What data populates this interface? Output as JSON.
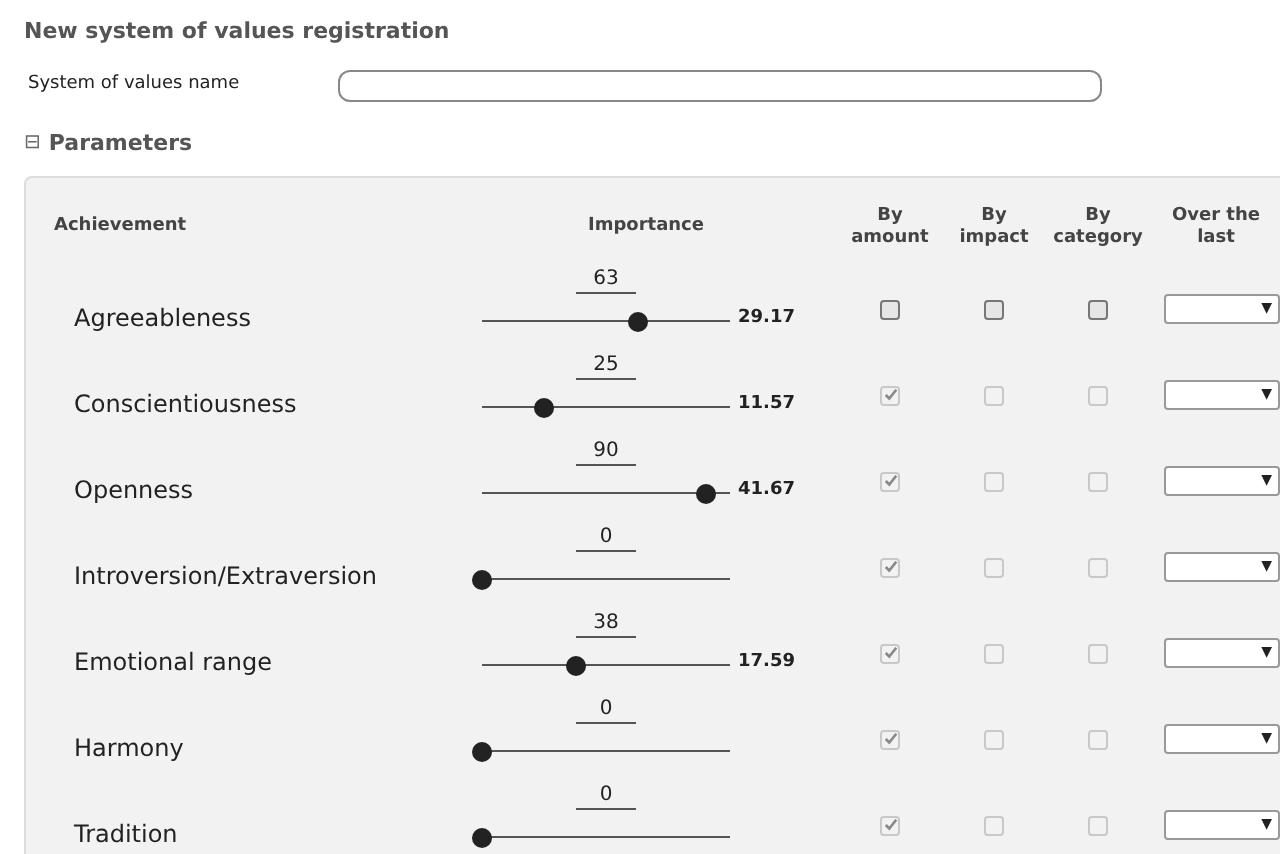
{
  "title": "New system of values registration",
  "name_field": {
    "label": "System of values name"
  },
  "parameters": {
    "label": "Parameters",
    "expanded": true,
    "toggle": "⊟"
  },
  "table": {
    "columns": [
      "Achievement",
      "Importance",
      "By amount",
      "By impact",
      "By category",
      "Over the last"
    ],
    "rows": [
      {
        "name": "Agreeableness",
        "importance": "63",
        "level": 0.63,
        "weight": "29.17",
        "by_amount": {
          "checked": false,
          "disabled": false
        },
        "by_impact": {
          "checked": false,
          "disabled": false
        },
        "by_category": {
          "checked": false,
          "disabled": false
        },
        "dropdown_arrow": "▼"
      },
      {
        "name": "Conscientiousness",
        "importance": "25",
        "level": 0.25,
        "weight": "11.57",
        "by_amount": {
          "checked": true,
          "disabled": true
        },
        "by_impact": {
          "checked": false,
          "disabled": true
        },
        "by_category": {
          "checked": false,
          "disabled": true
        },
        "dropdown_arrow": "▼"
      },
      {
        "name": "Openness",
        "importance": "90",
        "level": 0.9,
        "weight": "41.67",
        "by_amount": {
          "checked": true,
          "disabled": true
        },
        "by_impact": {
          "checked": false,
          "disabled": true
        },
        "by_category": {
          "checked": false,
          "disabled": true
        },
        "dropdown_arrow": "▼"
      },
      {
        "name": "Introversion/Extraversion",
        "importance": "0",
        "level": 0,
        "by_amount": {
          "checked": true,
          "disabled": true
        },
        "by_impact": {
          "checked": false,
          "disabled": true
        },
        "by_category": {
          "checked": false,
          "disabled": true
        },
        "dropdown_arrow": "▼"
      },
      {
        "name": "Emotional range",
        "importance": "38",
        "level": 0.38,
        "weight": "17.59",
        "by_amount": {
          "checked": true,
          "disabled": true
        },
        "by_impact": {
          "checked": false,
          "disabled": true
        },
        "by_category": {
          "checked": false,
          "disabled": true
        },
        "dropdown_arrow": "▼"
      },
      {
        "name": "Harmony",
        "importance": "0",
        "level": 0,
        "by_amount": {
          "checked": true,
          "disabled": true
        },
        "by_impact": {
          "checked": false,
          "disabled": true
        },
        "by_category": {
          "checked": false,
          "disabled": true
        },
        "dropdown_arrow": "▼"
      },
      {
        "name": "Tradition",
        "importance": "0",
        "level": 0,
        "by_amount": {
          "checked": true,
          "disabled": true
        },
        "by_impact": {
          "checked": false,
          "disabled": true
        },
        "by_category": {
          "checked": false,
          "disabled": true
        },
        "dropdown_arrow": "▼"
      }
    ]
  }
}
